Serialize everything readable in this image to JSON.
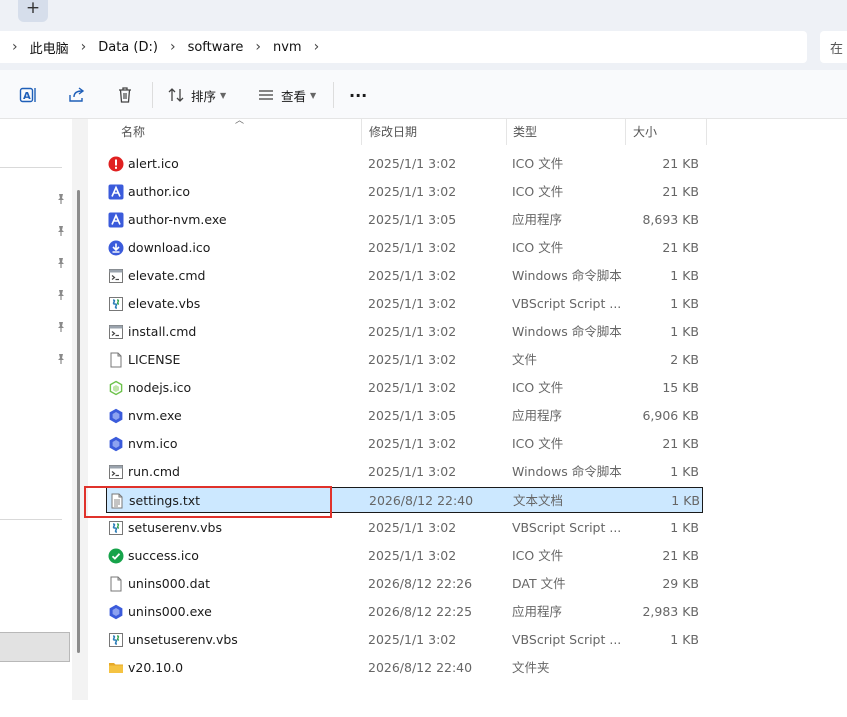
{
  "tabstrip": {
    "new_tab_label": "+"
  },
  "address": {
    "crumbs": [
      "此电脑",
      "Data (D:)",
      "software",
      "nvm"
    ],
    "search_placeholder": "在"
  },
  "toolbar": {
    "sort_label": "排序",
    "view_label": "查看",
    "more_label": "..."
  },
  "columns": {
    "name": "名称",
    "date": "修改日期",
    "type": "类型",
    "size": "大小"
  },
  "files": [
    {
      "name": "alert.ico",
      "date": "2025/1/1 3:02",
      "type": "ICO 文件",
      "size": "21 KB",
      "icon": "alert-icon"
    },
    {
      "name": "author.ico",
      "date": "2025/1/1 3:02",
      "type": "ICO 文件",
      "size": "21 KB",
      "icon": "author-icon"
    },
    {
      "name": "author-nvm.exe",
      "date": "2025/1/1 3:05",
      "type": "应用程序",
      "size": "8,693 KB",
      "icon": "author-icon"
    },
    {
      "name": "download.ico",
      "date": "2025/1/1 3:02",
      "type": "ICO 文件",
      "size": "21 KB",
      "icon": "download-icon"
    },
    {
      "name": "elevate.cmd",
      "date": "2025/1/1 3:02",
      "type": "Windows 命令脚本",
      "size": "1 KB",
      "icon": "cmd-file-icon"
    },
    {
      "name": "elevate.vbs",
      "date": "2025/1/1 3:02",
      "type": "VBScript Script ...",
      "size": "1 KB",
      "icon": "vbs-file-icon"
    },
    {
      "name": "install.cmd",
      "date": "2025/1/1 3:02",
      "type": "Windows 命令脚本",
      "size": "1 KB",
      "icon": "cmd-file-icon"
    },
    {
      "name": "LICENSE",
      "date": "2025/1/1 3:02",
      "type": "文件",
      "size": "2 KB",
      "icon": "blank-file-icon"
    },
    {
      "name": "nodejs.ico",
      "date": "2025/1/1 3:02",
      "type": "ICO 文件",
      "size": "15 KB",
      "icon": "nodejs-icon"
    },
    {
      "name": "nvm.exe",
      "date": "2025/1/1 3:05",
      "type": "应用程序",
      "size": "6,906 KB",
      "icon": "nvm-icon"
    },
    {
      "name": "nvm.ico",
      "date": "2025/1/1 3:02",
      "type": "ICO 文件",
      "size": "21 KB",
      "icon": "nvm-icon"
    },
    {
      "name": "run.cmd",
      "date": "2025/1/1 3:02",
      "type": "Windows 命令脚本",
      "size": "1 KB",
      "icon": "cmd-file-icon"
    },
    {
      "name": "settings.txt",
      "date": "2026/8/12 22:40",
      "type": "文本文档",
      "size": "1 KB",
      "icon": "text-file-icon",
      "selected": true
    },
    {
      "name": "setuserenv.vbs",
      "date": "2025/1/1 3:02",
      "type": "VBScript Script ...",
      "size": "1 KB",
      "icon": "vbs-file-icon"
    },
    {
      "name": "success.ico",
      "date": "2025/1/1 3:02",
      "type": "ICO 文件",
      "size": "21 KB",
      "icon": "success-icon"
    },
    {
      "name": "unins000.dat",
      "date": "2026/8/12 22:26",
      "type": "DAT 文件",
      "size": "29 KB",
      "icon": "blank-file-icon"
    },
    {
      "name": "unins000.exe",
      "date": "2026/8/12 22:25",
      "type": "应用程序",
      "size": "2,983 KB",
      "icon": "nvm-icon"
    },
    {
      "name": "unsetuserenv.vbs",
      "date": "2025/1/1 3:02",
      "type": "VBScript Script ...",
      "size": "1 KB",
      "icon": "vbs-file-icon"
    },
    {
      "name": "v20.10.0",
      "date": "2026/8/12 22:40",
      "type": "文件夹",
      "size": "",
      "icon": "folder-icon"
    }
  ],
  "colors": {
    "selection": "#cce8ff",
    "highlight_box": "#e0322b",
    "chrome": "#eef1f6",
    "alert": "#e02020",
    "success": "#16a34a",
    "nvm_blue": "#3b5bdb",
    "folder": "#f5c342",
    "nodejs": "#6cc24a"
  }
}
